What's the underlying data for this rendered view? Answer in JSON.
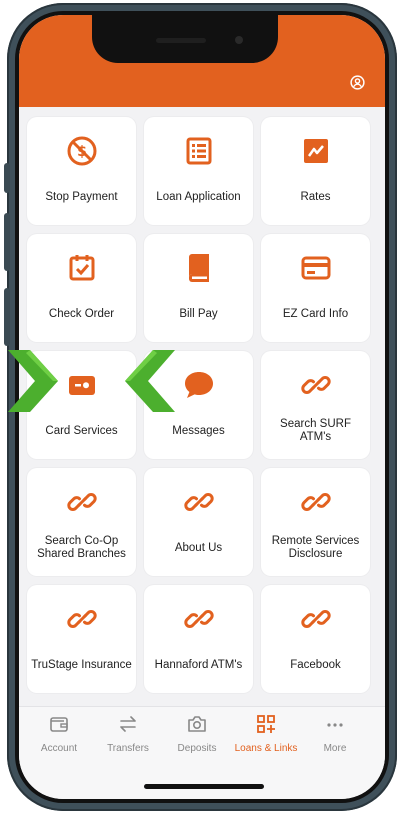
{
  "colors": {
    "accent": "#e2611f",
    "arrow": "#4caf2e",
    "tab_inactive": "#888888"
  },
  "tiles": [
    {
      "label": "Stop Payment",
      "icon": "no-money-icon"
    },
    {
      "label": "Loan Application",
      "icon": "list-document-icon"
    },
    {
      "label": "Rates",
      "icon": "line-chart-icon"
    },
    {
      "label": "Check Order",
      "icon": "calendar-check-icon"
    },
    {
      "label": "Bill Pay",
      "icon": "book-icon"
    },
    {
      "label": "EZ Card Info",
      "icon": "card-icon"
    },
    {
      "label": "Card Services",
      "icon": "card-toggle-icon"
    },
    {
      "label": "Messages",
      "icon": "speech-bubble-icon"
    },
    {
      "label": "Search SURF ATM's",
      "icon": "link-icon"
    },
    {
      "label": "Search Co-Op Shared Branches",
      "icon": "link-icon"
    },
    {
      "label": "About Us",
      "icon": "link-icon"
    },
    {
      "label": "Remote Services Disclosure",
      "icon": "link-icon"
    },
    {
      "label": "TruStage Insurance",
      "icon": "link-icon"
    },
    {
      "label": "Hannaford ATM's",
      "icon": "link-icon"
    },
    {
      "label": "Facebook",
      "icon": "link-icon"
    }
  ],
  "tabs": [
    {
      "label": "Account",
      "icon": "wallet-icon",
      "active": false
    },
    {
      "label": "Transfers",
      "icon": "arrows-icon",
      "active": false
    },
    {
      "label": "Deposits",
      "icon": "camera-icon",
      "active": false
    },
    {
      "label": "Loans & Links",
      "icon": "grid-plus-icon",
      "active": true
    },
    {
      "label": "More",
      "icon": "ellipsis-icon",
      "active": false
    }
  ]
}
